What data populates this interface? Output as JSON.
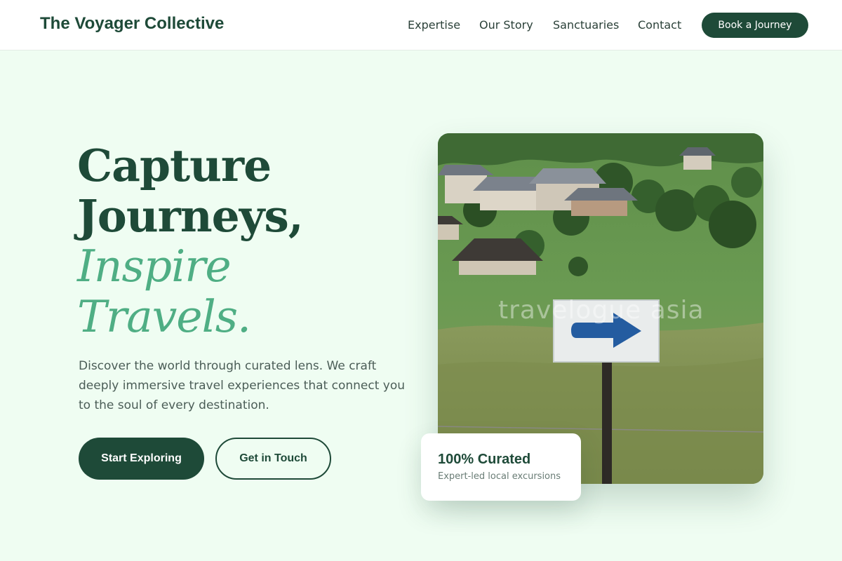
{
  "header": {
    "brand": "The Voyager Collective",
    "nav": [
      {
        "label": "Expertise"
      },
      {
        "label": "Our Story"
      },
      {
        "label": "Sanctuaries"
      },
      {
        "label": "Contact"
      }
    ],
    "cta_label": "Book a Journey"
  },
  "hero": {
    "headline_line1": "Capture",
    "headline_line2": "Journeys,",
    "headline_accent_line1": "Inspire",
    "headline_accent_line2": "Travels.",
    "description": "Discover the world through curated lens. We craft deeply immersive travel experiences that connect you to the soul of every destination.",
    "primary_button": "Start Exploring",
    "secondary_button": "Get in Touch",
    "image_watermark": "travelogue asia",
    "stat_card": {
      "title": "100% Curated",
      "subtitle": "Expert-led local excursions"
    }
  },
  "colors": {
    "brand_green": "#1e4a38",
    "accent_green": "#4fae84",
    "page_background": "#effdf2",
    "body_text": "#4b5d57"
  },
  "icons": {
    "hero_image_subject": "arrow-sign-photo"
  }
}
